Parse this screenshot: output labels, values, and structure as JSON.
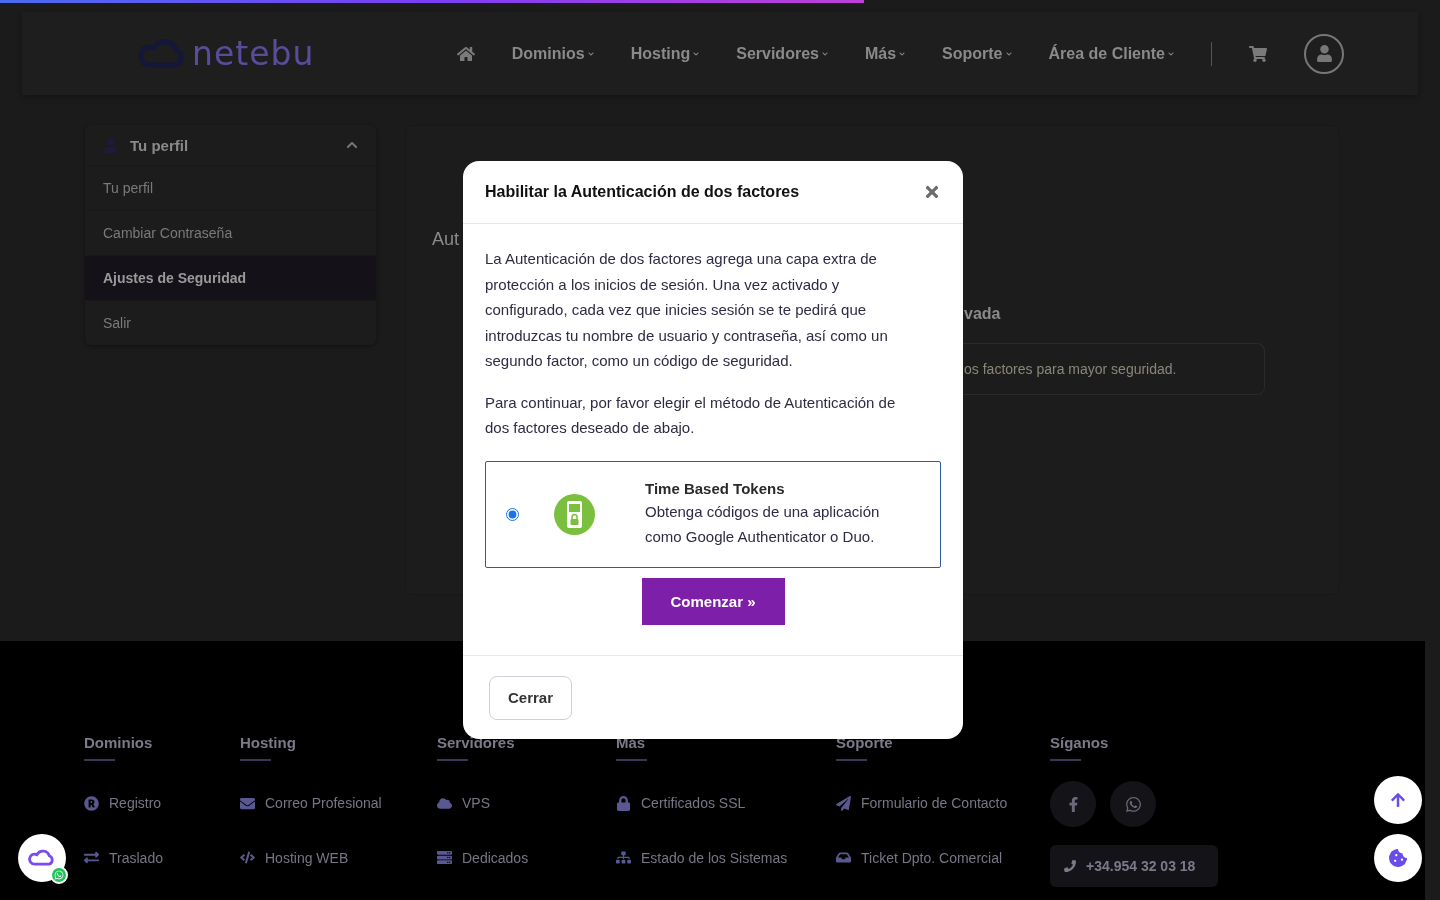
{
  "top_progress": {
    "level": 0.6
  },
  "header": {
    "logo": "netebu",
    "nav": [
      {
        "label": "Dominios"
      },
      {
        "label": "Hosting"
      },
      {
        "label": "Servidores"
      },
      {
        "label": "Más"
      },
      {
        "label": "Soporte"
      },
      {
        "label": "Área de Cliente"
      }
    ]
  },
  "sidebar": {
    "title": "Tu perfil",
    "expanded": true,
    "items": [
      {
        "label": "Tu perfil",
        "selected": false
      },
      {
        "label": "Cambiar Contraseña",
        "selected": false
      },
      {
        "label": "Ajustes de Seguridad",
        "selected": true
      },
      {
        "label": "Salir",
        "selected": false
      }
    ]
  },
  "content": {
    "heading_fragment": "Aut",
    "status_fragment": "vada",
    "alert_fragment": "os factores para mayor seguridad."
  },
  "modal": {
    "title": "Habilitar la Autenticación de dos factores",
    "paragraphs": [
      "La Autenticación de dos factores agrega una capa extra de protección a los inicios de sesión. Una vez activado y configurado, cada vez que inicies sesión se te pedirá que introduzcas tu nombre de usuario y contraseña, así como un segundo factor, como un código de seguridad.",
      "Para continuar, por favor elegir el método de Autenticación de dos factores deseado de abajo."
    ],
    "methods": [
      {
        "title": "Time Based Tokens",
        "description": "Obtenga códigos de una aplicación como Google Authenticator o Duo.",
        "selected": true
      }
    ],
    "start_button": "Comenzar »",
    "close_button": "Cerrar"
  },
  "footer": {
    "columns": [
      {
        "title": "Dominios",
        "links": [
          "Registro",
          "Traslado"
        ]
      },
      {
        "title": "Hosting",
        "links": [
          "Correo Profesional",
          "Hosting WEB"
        ]
      },
      {
        "title": "Servidores",
        "links": [
          "VPS",
          "Dedicados"
        ]
      },
      {
        "title": "Más",
        "links": [
          "Certificados SSL",
          "Estado de los Sistemas"
        ]
      },
      {
        "title": "Soporte",
        "links": [
          "Formulario de Contacto",
          "Ticket Dpto. Comercial"
        ]
      }
    ],
    "social": {
      "title": "Síganos",
      "phone": "+34.954 32 03 18"
    }
  }
}
